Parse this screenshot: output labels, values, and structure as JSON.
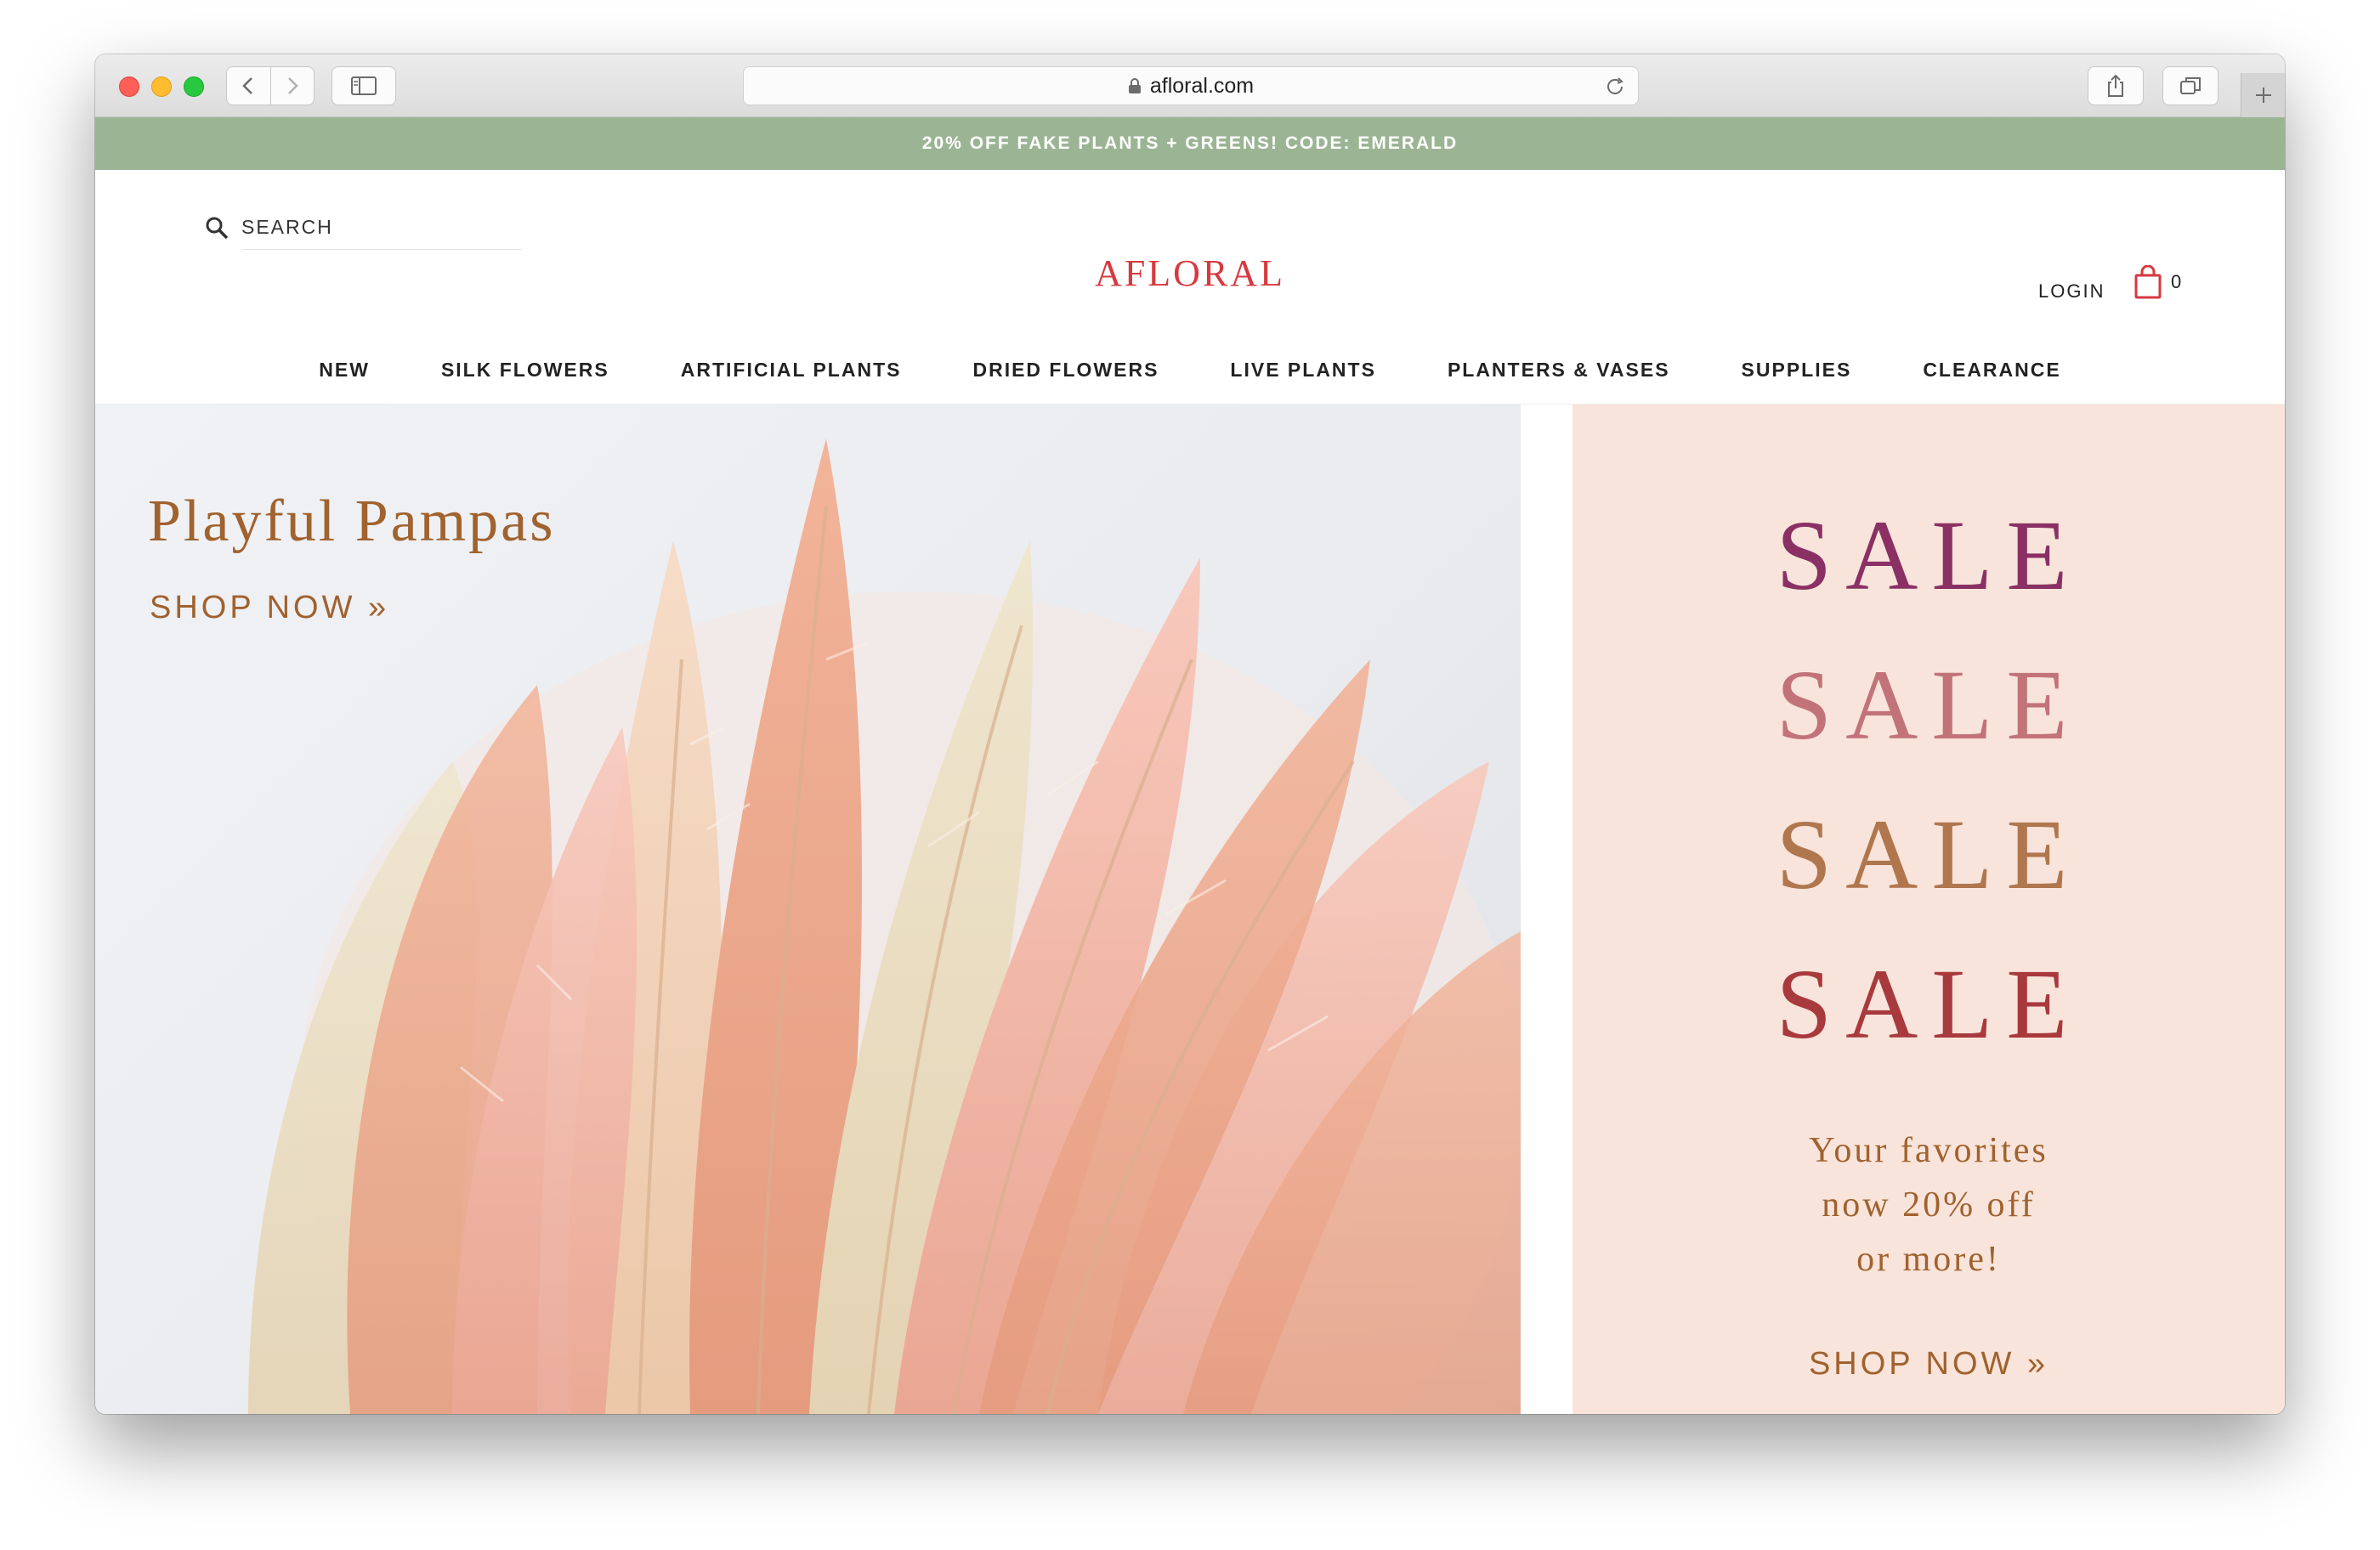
{
  "browser": {
    "url": "afloral.com"
  },
  "promo": {
    "text": "20% OFF FAKE PLANTS + GREENS! CODE: EMERALD"
  },
  "header": {
    "search_placeholder": "SEARCH",
    "logo": "AFLORAL",
    "login": "LOGIN",
    "cart_count": "0"
  },
  "nav": {
    "items": [
      {
        "label": "NEW"
      },
      {
        "label": "SILK FLOWERS"
      },
      {
        "label": "ARTIFICIAL PLANTS"
      },
      {
        "label": "DRIED FLOWERS"
      },
      {
        "label": "LIVE PLANTS"
      },
      {
        "label": "PLANTERS & VASES"
      },
      {
        "label": "SUPPLIES"
      },
      {
        "label": "CLEARANCE"
      }
    ]
  },
  "hero": {
    "title": "Playful Pampas",
    "cta": "SHOP NOW »"
  },
  "sale_panel": {
    "words": [
      "SALE",
      "SALE",
      "SALE",
      "SALE"
    ],
    "subtitle_lines": [
      "Your favorites",
      "now 20% off",
      "or more!"
    ],
    "cta": "SHOP NOW »"
  },
  "colors": {
    "promo_bg": "#9bb594",
    "logo": "#d63a3f",
    "hero_text": "#a0622e",
    "sale_panel_bg": "#f9e4db",
    "sale_1": "#8a3064",
    "sale_2": "#c2737a",
    "sale_3": "#b0764e",
    "sale_4": "#a8393d"
  },
  "icons": {
    "search": "search-icon",
    "cart": "shopping-bag-icon",
    "lock": "lock-icon",
    "reload": "reload-icon",
    "share": "share-icon",
    "tabs": "tabs-icon",
    "sidebar": "sidebar-icon",
    "new_tab": "plus-icon"
  }
}
